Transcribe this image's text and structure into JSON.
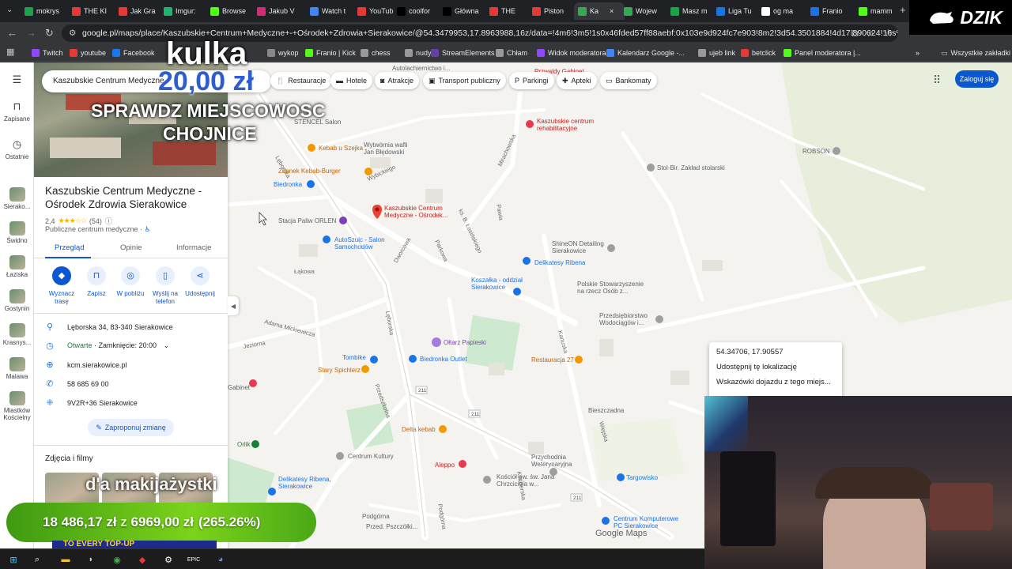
{
  "browser": {
    "tabs": [
      {
        "label": "mokrys",
        "color": "#1aa34a"
      },
      {
        "label": "THE KI",
        "color": "#e53935"
      },
      {
        "label": "Jak Gra",
        "color": "#e53935"
      },
      {
        "label": "Imgur:",
        "color": "#1bb76e"
      },
      {
        "label": "Browse",
        "color": "#53fc18"
      },
      {
        "label": "Jakub V",
        "color": "#d62976"
      },
      {
        "label": "Watch t",
        "color": "#4285f4"
      },
      {
        "label": "YouTub",
        "color": "#e53935"
      },
      {
        "label": "coolfor",
        "color": "#000000"
      },
      {
        "label": "Główna",
        "color": "#000000"
      },
      {
        "label": "THE",
        "color": "#e53935"
      },
      {
        "label": "Piston",
        "color": "#e53935"
      },
      {
        "label": "Ka",
        "color": "#34a853",
        "active": true
      },
      {
        "label": "Wojew",
        "color": "#34a853"
      },
      {
        "label": "Masz m",
        "color": "#1aa34a"
      },
      {
        "label": "Liga Tu",
        "color": "#1a73e8"
      },
      {
        "label": "og ma",
        "color": "#ffffff"
      },
      {
        "label": "Franio",
        "color": "#1a73e8"
      },
      {
        "label": "mamm",
        "color": "#53fc18"
      }
    ],
    "url": "google.pl/maps/place/Kaszubskie+Centrum+Medyczne+-+Ośrodek+Zdrowia+Sierakowice/@54.3479953,17.8963988,16z/data=!4m6!3m5!1s0x46fded57ff88aebf:0x103e9d924fc7e903!8m2!3d54.3501884!4d17.890624!16s%2Fg%2F1...",
    "bookmarks": [
      "Twitch",
      "youtube",
      "Facebook",
      "wykop",
      "Franio | Kick",
      "chess",
      "nudy",
      "StreamElements",
      "Chłam",
      "Widok moderatora...",
      "Kalendarz Google -...",
      "ujeb link",
      "betclick",
      "Panel moderatora |..."
    ],
    "all_bookmarks": "Wszystkie zakładki"
  },
  "rail": {
    "saved": "Zapisane",
    "recent": "Ostatnie",
    "places": [
      "Sierako...",
      "Świdno",
      "Łaziska",
      "Gostynin",
      "Krasnys...",
      "Malawa",
      "Miastków Kościelny"
    ]
  },
  "search": {
    "query": "Kaszubskie Centrum Medyczne -",
    "chips": [
      "Restauracje",
      "Hotele",
      "Atrakcje",
      "Transport publiczny",
      "Parkingi",
      "Apteki",
      "Bankomaty"
    ],
    "login": "Zaloguj się"
  },
  "place": {
    "name": "Kaszubskie Centrum Medyczne - Ośrodek Zdrowia Sierakowice",
    "rating": "2,4",
    "stars": "★★★☆☆",
    "reviews": "(54)",
    "category": "Publiczne centrum medyczne ·",
    "tabs": [
      "Przegląd",
      "Opinie",
      "Informacje"
    ],
    "actions": [
      "Wyznacz trasę",
      "Zapisz",
      "W pobliżu",
      "Wyślij na telefon",
      "Udostępnij"
    ],
    "address": "Lęborska 34, 83-340 Sierakowice",
    "hours_status": "Otwarte",
    "hours_close": " · Zamknięcie: 20:00",
    "website": "kcm.sierakowice.pl",
    "phone": "58 685 69 00",
    "plus_code": "9V2R+36 Sierakowice",
    "suggest_edit": "Zaproponuj zmianę",
    "photos_title": "Zdjęcia i filmy"
  },
  "map": {
    "pois": {
      "stencel": "STENCEL Salon",
      "wytwornia": "Wytwórnia wafli",
      "wytwornia2": "Jan Błędowski",
      "kebab_szejk": "Kebab u Szejka",
      "zdanek": "Zdanek Kebab-Burger",
      "biedronka1": "Biedronka",
      "orlen": "Stacja Paliw ORLEN",
      "kcm1": "Kaszubskie Centrum",
      "kcm2": "Medyczne - Ośrodek...",
      "autoszulc1": "AutoSzulc - Salon",
      "autoszulc2": "Samochodów",
      "rehab1": "Kaszubskie centrum",
      "rehab2": "rehabilitacyjne",
      "autolacker": "Autolachiernictwo i...",
      "pszwaldy": "Przwaldy Gabinet",
      "ribena": "Delikatesy Ribena",
      "shineon1": "ShineON Detailing",
      "shineon2": "Sierakowice",
      "koszalka1": "Koszałka - oddział",
      "koszalka2": "Sierakowice",
      "pstow1": "Polskie Stowarzyszenie",
      "pstow2": "na rzecz Osób z...",
      "przedsiebiorstwo1": "Przedsiębiorstwo",
      "przedsiebiorstwo2": "Wodociągów i...",
      "oltarz": "Ołtarz Papieski",
      "biedronka_outlet": "Biedronka Outlet",
      "rzeczpospolita": "Restauracja 27",
      "tombike": "Tombike",
      "starySpichlerz": "Stary Spichlerz",
      "gabinet": "Gabinet",
      "delta": "Delta kebab",
      "centrum": "Centrum Kultury",
      "aleppo": "Aleppo",
      "delik2a": "Delikatesy Ribena,",
      "delik2b": "Sierakowice",
      "kosciol1": "Kościół pw. św. Jana",
      "kosciol2": "Chrzciciela w...",
      "przychodnia1": "Przychodnia",
      "przychodnia2": "Weterynaryjna",
      "targowisko": "Targowisko",
      "orlik": "Orlik",
      "komputerowe1": "Centrum Komputerowe",
      "komputerowe2": "PC Sierakowice",
      "robson": "ROBSON",
      "stolbir": "Stol-Bir. Zakład stolarski",
      "bieszczadna": "Bieszczadna",
      "podgorna": "Podgórna",
      "pszczolki": "Przed. Pszczółki..."
    },
    "streets": [
      "Lęborska",
      "Wybickiego",
      "Dworcowa",
      "Mirachowska",
      "Pawia",
      "Łąkowa",
      "Adama Mickiewicza",
      "Jeziorna",
      "Przedszkolna",
      "Kościerska",
      "Kartuska",
      "Lipowa",
      "ks. B. Łosińskiego",
      "Parkowa",
      "Wiejska",
      "Piwna",
      "Ogrodowa",
      "Podgórna"
    ],
    "road_numbers": [
      "211",
      "211",
      "211"
    ],
    "attribution": "Google Maps"
  },
  "context_menu": {
    "coords": "54.34706, 17.90557",
    "share": "Udostępnij tę lokalizację",
    "directions": "Wskazówki dojazdu z tego miejs..."
  },
  "stream": {
    "brand": "DZIK",
    "overlay_title": "kulka",
    "overlay_price": "20,00 zł",
    "overlay_line1": "SPRAWDZ MIEJSCOWOSC",
    "overlay_line2": "CHOJNICE",
    "overlay_bottom": "d'a makijażystki",
    "goal_current": "18 486,17 zł",
    "goal_of": " z ",
    "goal_target": "6969,00 zł",
    "goal_percent": "(265.26%)",
    "goal_banner": "TO EVERY TOP-UP"
  },
  "colors": {
    "accent": "#0b57d0",
    "map_bg": "#f5f3ef",
    "goal_green": "#7bd31a"
  }
}
